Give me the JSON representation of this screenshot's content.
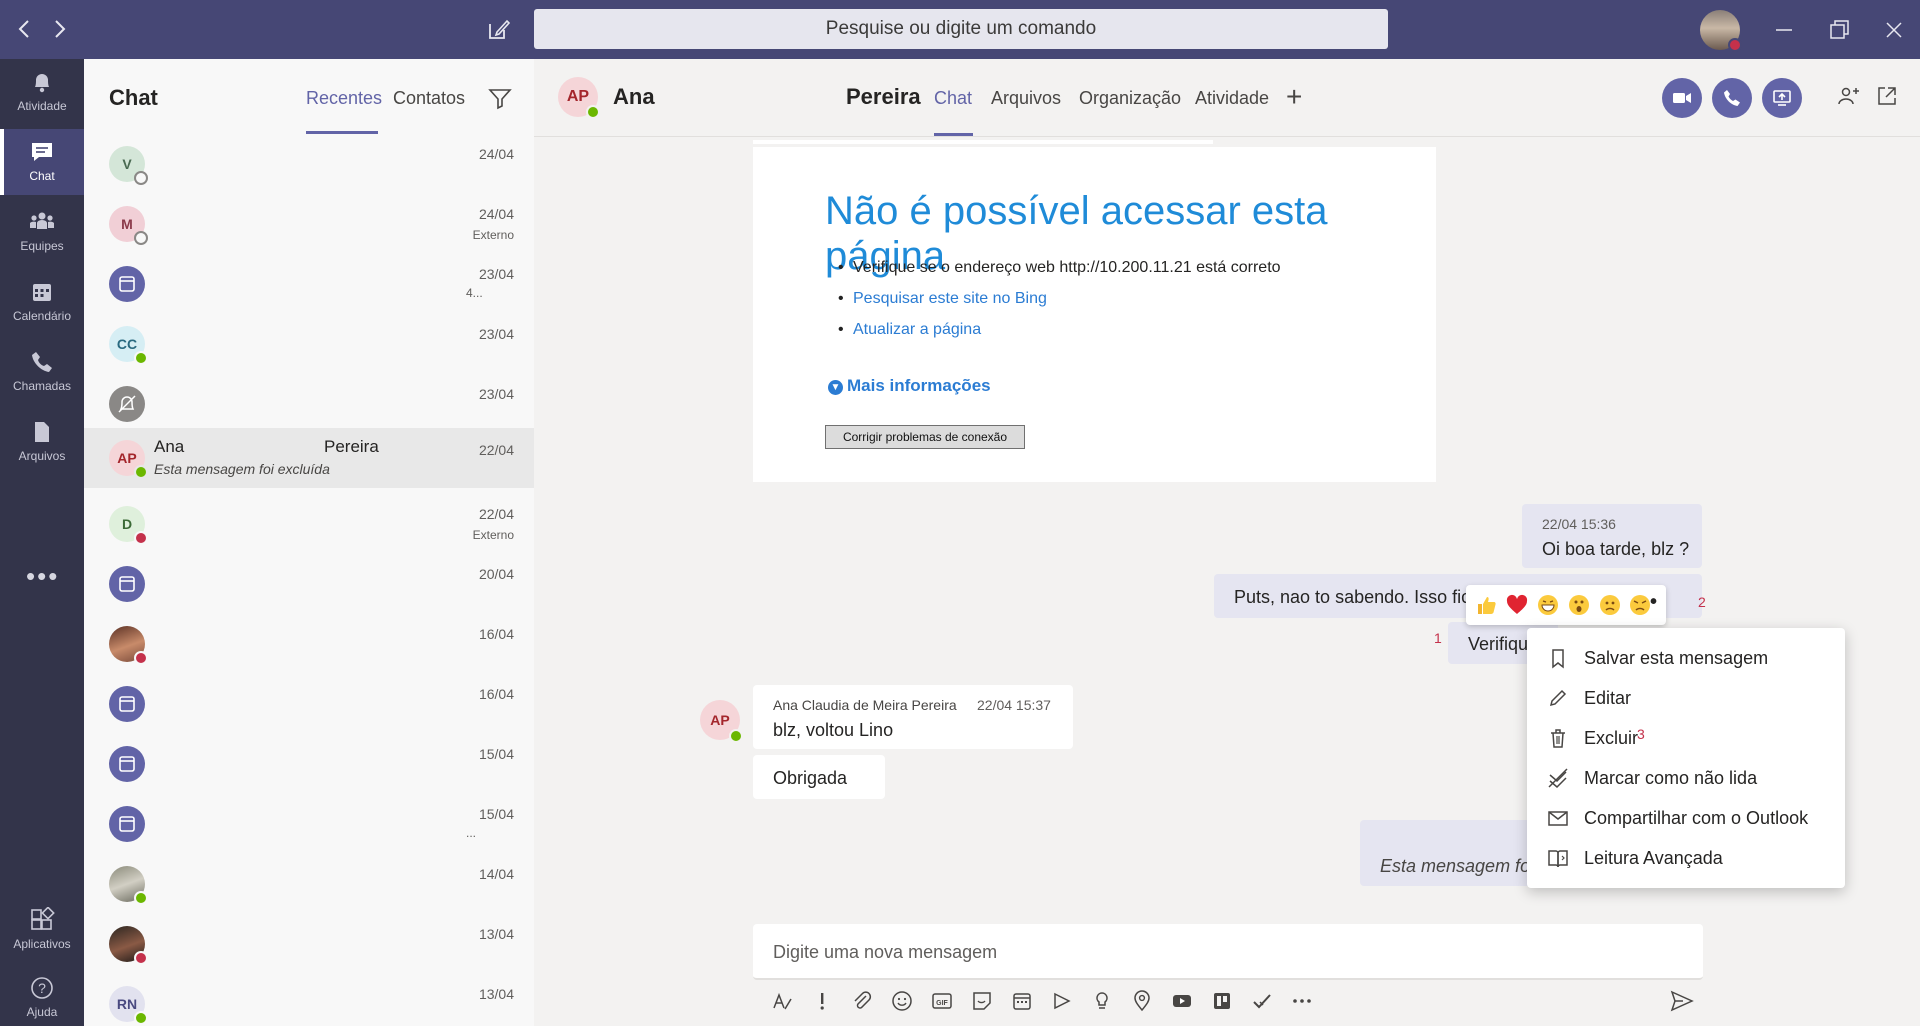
{
  "titlebar": {
    "search_placeholder": "Pesquise ou digite um comando"
  },
  "rail": {
    "items": [
      {
        "label": "Atividade",
        "icon": "bell-icon"
      },
      {
        "label": "Chat",
        "icon": "chat-icon",
        "active": true
      },
      {
        "label": "Equipes",
        "icon": "teams-icon"
      },
      {
        "label": "Calendário",
        "icon": "calendar-icon"
      },
      {
        "label": "Chamadas",
        "icon": "phone-icon"
      },
      {
        "label": "Arquivos",
        "icon": "files-icon"
      }
    ],
    "more": "•••",
    "bottom": [
      {
        "label": "Aplicativos",
        "icon": "apps-icon"
      },
      {
        "label": "Ajuda",
        "icon": "help-icon"
      }
    ]
  },
  "chat_list": {
    "title": "Chat",
    "tabs": [
      "Recentes",
      "Contatos"
    ],
    "rows": [
      {
        "initials": "V",
        "date": "24/04",
        "sub": "",
        "status": "offline"
      },
      {
        "initials": "M",
        "date": "24/04",
        "sub": "Externo",
        "status": "offline"
      },
      {
        "initials": "",
        "date": "23/04",
        "sub": "4...",
        "status": "calendar"
      },
      {
        "initials": "CC",
        "date": "23/04",
        "sub": "",
        "status": "available"
      },
      {
        "initials": "",
        "date": "23/04",
        "sub": "",
        "status": "muted"
      },
      {
        "initials": "AP",
        "name_first": "Ana",
        "name_last": "Pereira",
        "preview": "Esta mensagem foi excluída",
        "date": "22/04",
        "sub": "",
        "status": "available",
        "selected": true
      },
      {
        "initials": "D",
        "date": "22/04",
        "sub": "Externo",
        "status": "busy"
      },
      {
        "initials": "",
        "date": "20/04",
        "sub": "",
        "status": "calendar"
      },
      {
        "initials": "",
        "date": "16/04",
        "sub": "",
        "status": "photo-busy"
      },
      {
        "initials": "",
        "date": "16/04",
        "sub": "",
        "status": "calendar"
      },
      {
        "initials": "",
        "date": "15/04",
        "sub": "",
        "status": "calendar"
      },
      {
        "initials": "",
        "date": "15/04",
        "sub": "...",
        "status": "calendar"
      },
      {
        "initials": "",
        "date": "14/04",
        "sub": "",
        "status": "photo-available"
      },
      {
        "initials": "",
        "date": "13/04",
        "sub": "",
        "status": "photo-dnd"
      },
      {
        "initials": "RN",
        "date": "13/04",
        "sub": "",
        "status": "available"
      }
    ]
  },
  "header": {
    "initials": "AP",
    "name_first": "Ana",
    "name_last": "Pereira",
    "tabs": [
      "Chat",
      "Arquivos",
      "Organização",
      "Atividade"
    ],
    "active_tab": "Chat",
    "add_tab": "+"
  },
  "error_page": {
    "title": "Não é possível acessar esta página",
    "bullets": [
      "Verifique se o endereço web http://10.200.11.21 está correto",
      "Pesquisar este site no Bing",
      "Atualizar a página"
    ],
    "more_info": "Mais informações",
    "fix_button": "Corrigir problemas de conexão"
  },
  "messages": {
    "me_1_time": "22/04 15:36",
    "me_1_text": "Oi boa tarde, blz ?",
    "me_2_text": "Puts, nao to sabendo. Isso fica",
    "me_3_text": "Verifique",
    "other_sender": "Ana Claudia de Meira Pereira",
    "other_time": "22/04 15:37",
    "other_1": "blz, voltou Lino",
    "other_2": "Obrigada",
    "deleted": "Esta mensagem foi e"
  },
  "reactions": [
    "like",
    "heart",
    "laugh",
    "surprised",
    "sad",
    "angry"
  ],
  "reactions_more": "•••",
  "badges": {
    "one": "1",
    "two": "2",
    "three": "3"
  },
  "context_menu": [
    {
      "label": "Salvar esta mensagem",
      "icon": "bookmark-icon"
    },
    {
      "label": "Editar",
      "icon": "pencil-icon"
    },
    {
      "label": "Excluir",
      "icon": "trash-icon"
    },
    {
      "label": "Marcar como não lida",
      "icon": "unread-icon"
    },
    {
      "label": "Compartilhar com o Outlook",
      "icon": "mail-icon"
    },
    {
      "label": "Leitura Avançada",
      "icon": "immersive-reader-icon"
    }
  ],
  "composer": {
    "placeholder": "Digite uma nova mensagem"
  },
  "colors": {
    "brand": "#6264a7",
    "titlebar": "#464775",
    "rail": "#33344a",
    "available": "#6bb700",
    "busy": "#c4314b"
  }
}
